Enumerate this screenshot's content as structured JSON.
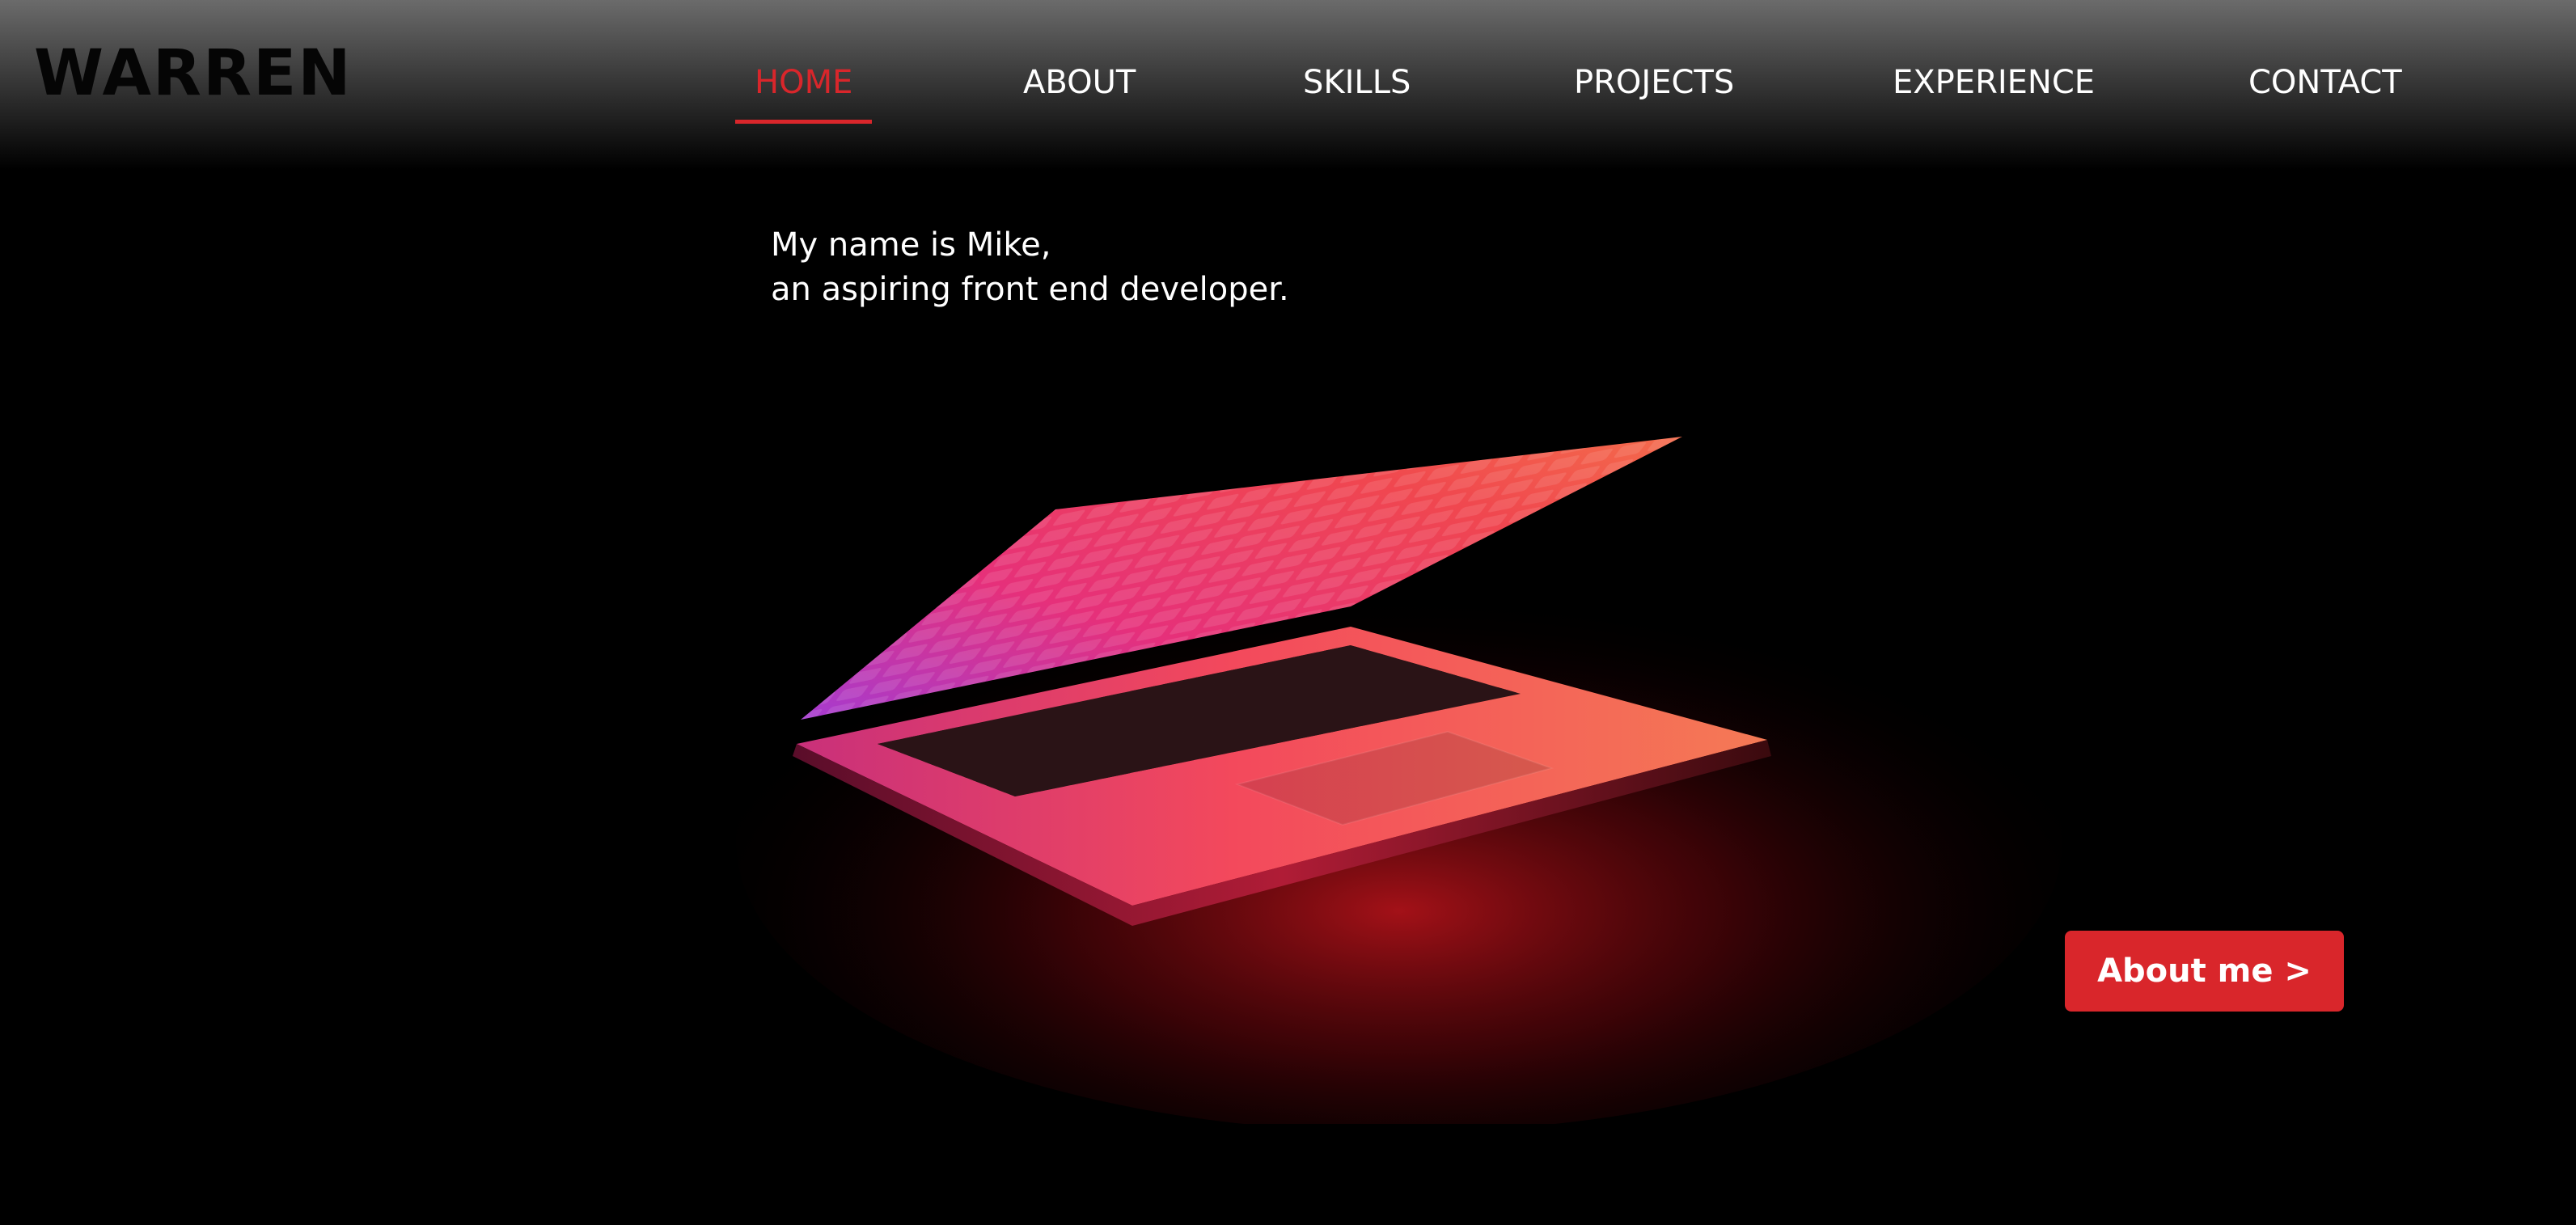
{
  "brand": {
    "logo_text": "WARREN"
  },
  "nav": {
    "items": [
      {
        "label": "HOME",
        "active": true
      },
      {
        "label": "ABOUT",
        "active": false
      },
      {
        "label": "SKILLS",
        "active": false
      },
      {
        "label": "PROJECTS",
        "active": false
      },
      {
        "label": "EXPERIENCE",
        "active": false
      },
      {
        "label": "CONTACT",
        "active": false
      }
    ]
  },
  "intro": {
    "line1": "My name is Mike,",
    "line2": "an aspiring front end developer."
  },
  "cta": {
    "label": "About me >"
  },
  "colors": {
    "accent": "#d9262b",
    "background": "#000000",
    "text": "#ffffff"
  },
  "hero": {
    "image": "glowing-laptop-illustration"
  }
}
